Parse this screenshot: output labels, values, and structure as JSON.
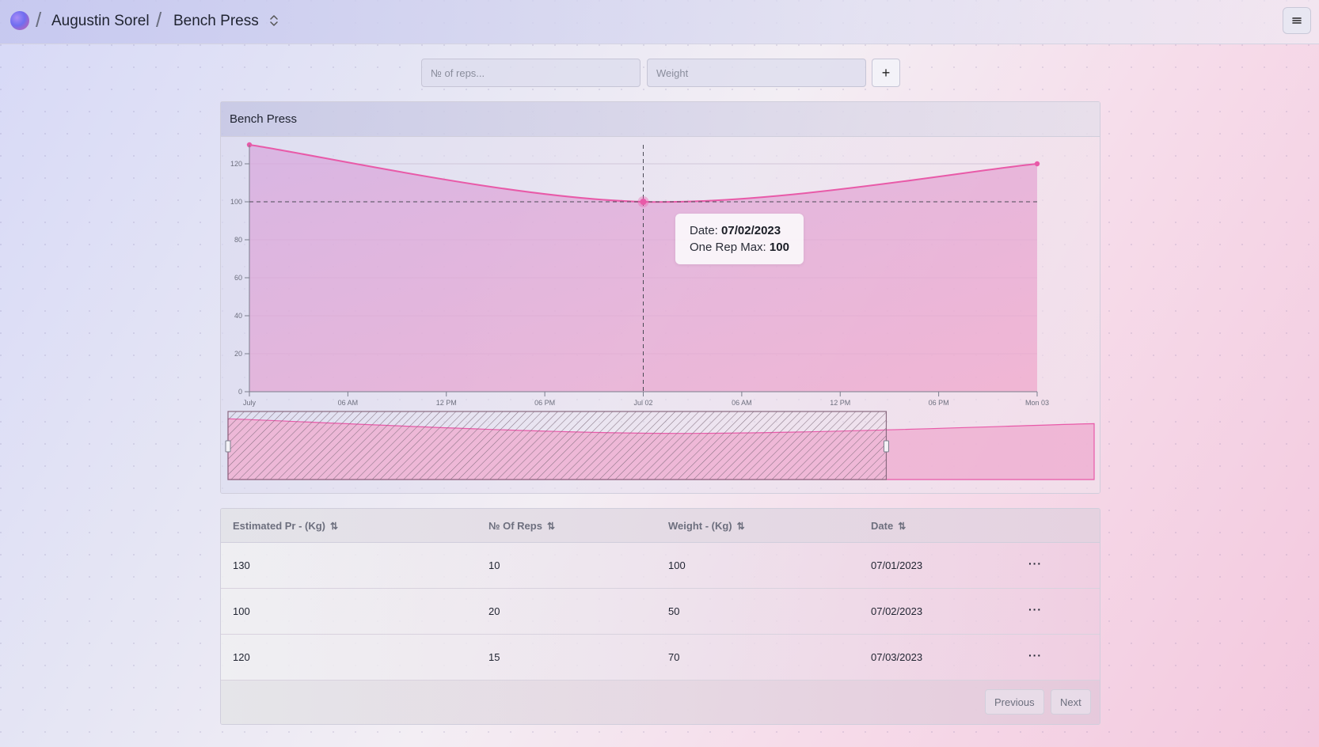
{
  "header": {
    "user_name": "Augustin Sorel",
    "exercise_name": "Bench Press",
    "separator": "/"
  },
  "form": {
    "reps_placeholder": "№ of reps...",
    "weight_placeholder": "Weight",
    "add_label": "+"
  },
  "chart_card": {
    "title": "Bench Press"
  },
  "chart_data": {
    "type": "area",
    "title": "",
    "xlabel": "",
    "ylabel": "",
    "x": [
      "07/01/2023",
      "07/02/2023",
      "07/03/2023"
    ],
    "x_ticks": [
      "July",
      "06 AM",
      "12 PM",
      "06 PM",
      "Jul 02",
      "06 AM",
      "12 PM",
      "06 PM",
      "Mon 03"
    ],
    "y_ticks": [
      0,
      20,
      40,
      60,
      80,
      100,
      120
    ],
    "ylim": [
      0,
      130
    ],
    "series": [
      {
        "name": "One Rep Max",
        "values": [
          130,
          100,
          120
        ]
      }
    ],
    "colors": {
      "line": "#e85aa8",
      "fill": "#e88cc4"
    },
    "grid": true,
    "tooltip": {
      "date_label": "Date:",
      "date_value": "07/02/2023",
      "value_label": "One Rep Max:",
      "value": "100"
    },
    "zoom_window": {
      "start": 0.0,
      "end": 0.76
    }
  },
  "table": {
    "columns": [
      "Estimated Pr - (Kg)",
      "№ Of Reps",
      "Weight - (Kg)",
      "Date"
    ],
    "sort_icon": "⇅",
    "rows": [
      {
        "pr": "130",
        "reps": "10",
        "weight": "100",
        "date": "07/01/2023",
        "actions": "···"
      },
      {
        "pr": "100",
        "reps": "20",
        "weight": "50",
        "date": "07/02/2023",
        "actions": "···"
      },
      {
        "pr": "120",
        "reps": "15",
        "weight": "70",
        "date": "07/03/2023",
        "actions": "···"
      }
    ],
    "pagination": {
      "previous": "Previous",
      "next": "Next"
    }
  }
}
